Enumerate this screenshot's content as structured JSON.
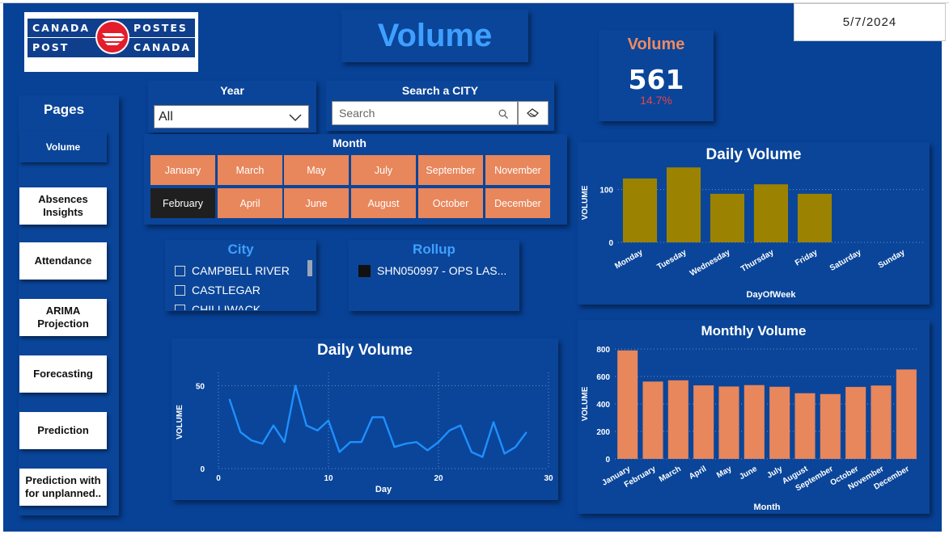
{
  "header": {
    "title": "Volume",
    "date": "5/7/2024",
    "logo": {
      "left_top": "CANADA",
      "left_bottom": "POST",
      "right_top": "POSTES",
      "right_bottom": "CANADA"
    }
  },
  "kpi": {
    "label": "Volume",
    "value": "561",
    "change": "14.7%"
  },
  "nav": {
    "title": "Pages",
    "items": [
      {
        "label": "Volume",
        "active": true
      },
      {
        "label": "Absences Insights"
      },
      {
        "label": "Attendance"
      },
      {
        "label": "ARIMA Projection"
      },
      {
        "label": "Forecasting"
      },
      {
        "label": "Prediction"
      },
      {
        "label": "Prediction with for unplanned.."
      }
    ]
  },
  "filters": {
    "year_label": "Year",
    "year_value": "All",
    "search_label": "Search a CITY",
    "search_placeholder": "Search",
    "month_label": "Month",
    "months": [
      "January",
      "March",
      "May",
      "July",
      "September",
      "November",
      "February",
      "April",
      "June",
      "August",
      "October",
      "December"
    ],
    "selected_month": "February",
    "city_label": "City",
    "cities": [
      "CAMPBELL RIVER",
      "CASTLEGAR",
      "CHILLIWACK"
    ],
    "rollup_label": "Rollup",
    "rollup_item": "SHN050997 - OPS LAS..."
  },
  "colors": {
    "background": "#084297",
    "accent": "#3fa0ff",
    "orange": "#e8865c",
    "olive": "#9b8200"
  },
  "chart_data": [
    {
      "type": "bar",
      "title": "Daily Volume",
      "xlabel": "DayOfWeek",
      "ylabel": "VOLUME",
      "categories": [
        "Monday",
        "Tuesday",
        "Wednesday",
        "Thursday",
        "Friday",
        "Saturday",
        "Sunday"
      ],
      "values": [
        121,
        142,
        92,
        110,
        92,
        0,
        0
      ],
      "yticks": [
        0,
        100
      ],
      "ylim": [
        0,
        150
      ],
      "color": "#9b8200",
      "grid": true
    },
    {
      "type": "line",
      "title": "Daily Volume",
      "xlabel": "Day",
      "ylabel": "VOLUME",
      "x": [
        1,
        2,
        3,
        4,
        5,
        6,
        7,
        8,
        9,
        10,
        11,
        12,
        13,
        14,
        15,
        16,
        17,
        18,
        19,
        20,
        21,
        22,
        23,
        24,
        25,
        26,
        27,
        28
      ],
      "y": [
        42,
        22,
        17,
        15,
        26,
        16,
        50,
        26,
        23,
        29,
        10,
        16,
        16,
        31,
        31,
        13,
        15,
        16,
        11,
        16,
        23,
        26,
        10,
        7,
        28,
        9,
        13,
        22
      ],
      "xticks": [
        0,
        10,
        20,
        30
      ],
      "yticks": [
        0,
        50
      ],
      "xlim": [
        0,
        30
      ],
      "ylim": [
        0,
        58
      ],
      "color": "#1e90ff",
      "grid": true
    },
    {
      "type": "bar",
      "title": "Monthly Volume",
      "xlabel": "Month",
      "ylabel": "VOLUME",
      "categories": [
        "January",
        "February",
        "March",
        "April",
        "May",
        "June",
        "July",
        "August",
        "September",
        "October",
        "November",
        "December"
      ],
      "values": [
        790,
        563,
        572,
        535,
        527,
        537,
        525,
        478,
        472,
        524,
        534,
        651
      ],
      "yticks": [
        0,
        200,
        400,
        600,
        800
      ],
      "ylim": [
        0,
        800
      ],
      "color": "#e8865c",
      "grid": true
    }
  ]
}
